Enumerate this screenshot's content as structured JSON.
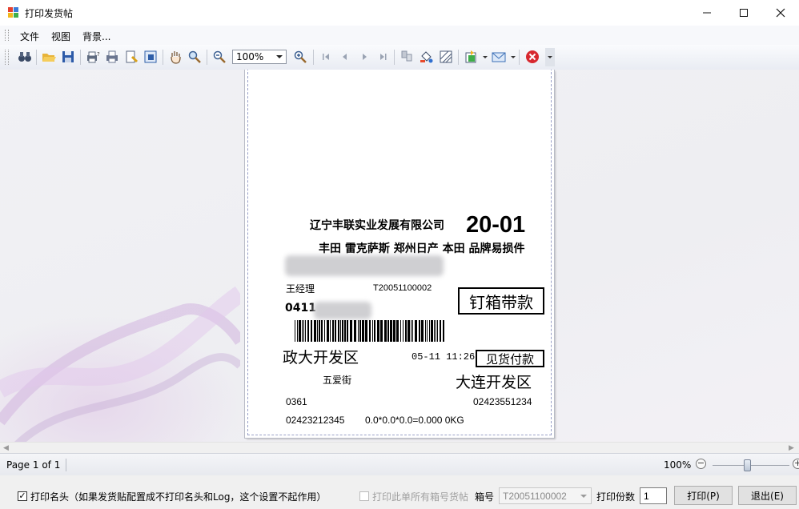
{
  "window": {
    "title": "打印发货帖"
  },
  "menu": {
    "file": "文件",
    "view": "视图",
    "background": "背景..."
  },
  "toolbar": {
    "zoom_value": "100%"
  },
  "label": {
    "company": "辽宁丰联实业发展有限公司",
    "route_code": "20-01",
    "brands": "丰田 雷克萨斯 郑州日产 本田 品牌易损件",
    "contact": "王经理",
    "order_no": "T20051100002",
    "stamp_pack": "钉箱带款",
    "phone_prefix": "0411",
    "dest_from": "政大开发区",
    "time": "05-11 11:26",
    "stamp_payment": "见货付款",
    "street": "五爱街",
    "dest_to": "大连开发区",
    "code_a": "0361",
    "phone_b": "02423551234",
    "phone_c": "02423212345",
    "weight": "0.0*0.0*0.0=0.000 0KG"
  },
  "status": {
    "page": "Page 1 of 1",
    "zoom": "100%",
    "zoom_level_percent": 45
  },
  "bottom": {
    "print_header_label": "打印名头（如果发货贴配置成不打印名头和Log，这个设置不起作用）",
    "print_header_checked": true,
    "print_all_boxes_label": "打印此单所有箱号货帖",
    "box_no_label": "箱号",
    "box_no_value": "T20051100002",
    "copies_label": "打印份数",
    "copies_value": "1",
    "print_button": "打印(P)",
    "exit_button": "退出(E)"
  }
}
